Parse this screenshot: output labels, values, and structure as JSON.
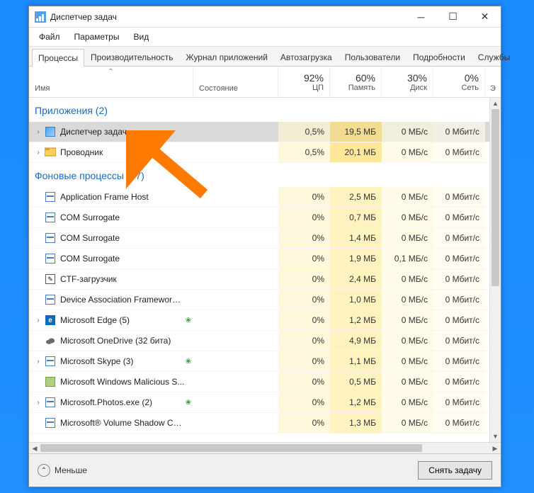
{
  "window": {
    "title": "Диспетчер задач"
  },
  "menubar": {
    "file": "Файл",
    "options": "Параметры",
    "view": "Вид"
  },
  "tabs": [
    "Процессы",
    "Производительность",
    "Журнал приложений",
    "Автозагрузка",
    "Пользователи",
    "Подробности",
    "Службы"
  ],
  "columns": {
    "name": "Имя",
    "state": "Состояние",
    "cpu": {
      "pct": "92%",
      "label": "ЦП"
    },
    "mem": {
      "pct": "60%",
      "label": "Память"
    },
    "disk": {
      "pct": "30%",
      "label": "Диск"
    },
    "net": {
      "pct": "0%",
      "label": "Сеть"
    },
    "extra": "Э"
  },
  "groups": {
    "apps": "Приложения (2)",
    "bg": "Фоновые процессы (37)"
  },
  "rows": [
    {
      "group": "apps",
      "name": "Диспетчер задач",
      "expand": true,
      "icon": "tm",
      "leaf": false,
      "cpu": "0,5%",
      "mem": "19,5 МБ",
      "disk": "0 МБ/с",
      "net": "0 Мбит/с",
      "selected": true
    },
    {
      "group": "apps",
      "name": "Проводник",
      "expand": true,
      "icon": "explorer",
      "leaf": false,
      "cpu": "0,5%",
      "mem": "20,1 МБ",
      "disk": "0 МБ/с",
      "net": "0 Мбит/с"
    },
    {
      "group": "bg",
      "name": "Application Frame Host",
      "expand": false,
      "icon": "app",
      "leaf": false,
      "cpu": "0%",
      "mem": "2,5 МБ",
      "disk": "0 МБ/с",
      "net": "0 Мбит/с"
    },
    {
      "group": "bg",
      "name": "COM Surrogate",
      "expand": false,
      "icon": "app",
      "leaf": false,
      "cpu": "0%",
      "mem": "0,7 МБ",
      "disk": "0 МБ/с",
      "net": "0 Мбит/с"
    },
    {
      "group": "bg",
      "name": "COM Surrogate",
      "expand": false,
      "icon": "app",
      "leaf": false,
      "cpu": "0%",
      "mem": "1,4 МБ",
      "disk": "0 МБ/с",
      "net": "0 Мбит/с"
    },
    {
      "group": "bg",
      "name": "COM Surrogate",
      "expand": false,
      "icon": "app",
      "leaf": false,
      "cpu": "0%",
      "mem": "1,9 МБ",
      "disk": "0,1 МБ/с",
      "net": "0 Мбит/с"
    },
    {
      "group": "bg",
      "name": "CTF-загрузчик",
      "expand": false,
      "icon": "ctf",
      "leaf": false,
      "cpu": "0%",
      "mem": "2,4 МБ",
      "disk": "0 МБ/с",
      "net": "0 Мбит/с"
    },
    {
      "group": "bg",
      "name": "Device Association Framework ...",
      "expand": false,
      "icon": "app",
      "leaf": false,
      "cpu": "0%",
      "mem": "1,0 МБ",
      "disk": "0 МБ/с",
      "net": "0 Мбит/с"
    },
    {
      "group": "bg",
      "name": "Microsoft Edge (5)",
      "expand": true,
      "icon": "edge",
      "leaf": true,
      "cpu": "0%",
      "mem": "1,2 МБ",
      "disk": "0 МБ/с",
      "net": "0 Мбит/с"
    },
    {
      "group": "bg",
      "name": "Microsoft OneDrive (32 бита)",
      "expand": false,
      "icon": "cloud",
      "leaf": false,
      "cpu": "0%",
      "mem": "4,9 МБ",
      "disk": "0 МБ/с",
      "net": "0 Мбит/с"
    },
    {
      "group": "bg",
      "name": "Microsoft Skype (3)",
      "expand": true,
      "icon": "app",
      "leaf": true,
      "cpu": "0%",
      "mem": "1,1 МБ",
      "disk": "0 МБ/с",
      "net": "0 Мбит/с"
    },
    {
      "group": "bg",
      "name": "Microsoft Windows Malicious S...",
      "expand": false,
      "icon": "cam",
      "leaf": false,
      "cpu": "0%",
      "mem": "0,5 МБ",
      "disk": "0 МБ/с",
      "net": "0 Мбит/с"
    },
    {
      "group": "bg",
      "name": "Microsoft.Photos.exe (2)",
      "expand": true,
      "icon": "app",
      "leaf": true,
      "cpu": "0%",
      "mem": "1,2 МБ",
      "disk": "0 МБ/с",
      "net": "0 Мбит/с"
    },
    {
      "group": "bg",
      "name": "Microsoft® Volume Shadow Co...",
      "expand": false,
      "icon": "app",
      "leaf": false,
      "cpu": "0%",
      "mem": "1,3 МБ",
      "disk": "0 МБ/с",
      "net": "0 Мбит/с"
    }
  ],
  "footer": {
    "fewer": "Меньше",
    "end_task": "Снять задачу"
  }
}
